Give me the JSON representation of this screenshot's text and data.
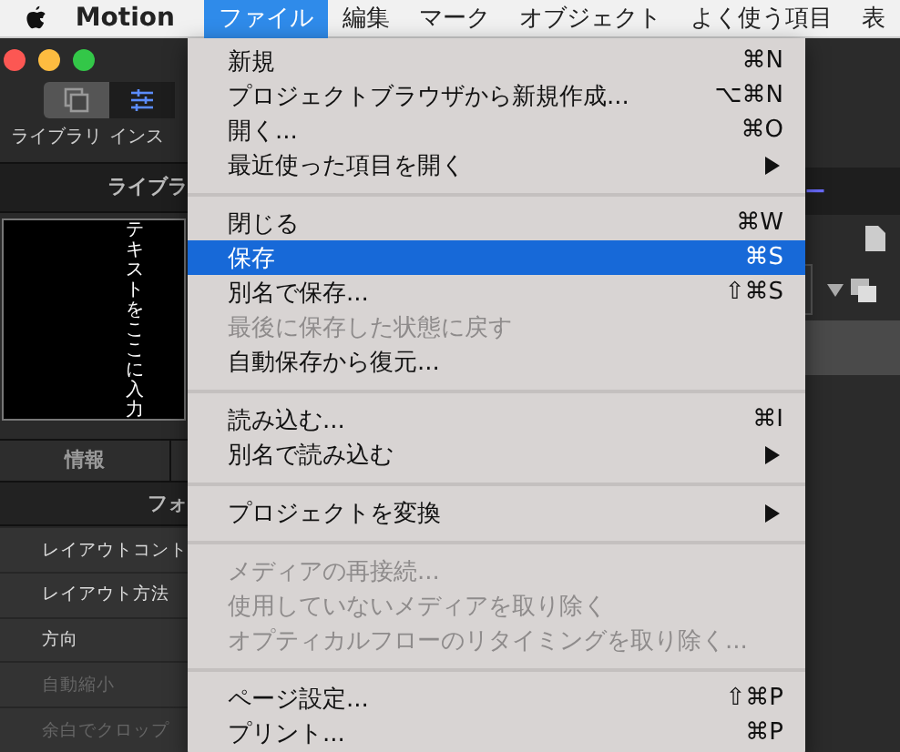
{
  "menubar": {
    "app_name": "Motion",
    "items": [
      {
        "kind": "menu",
        "label": "ファイル",
        "selected": true
      },
      {
        "kind": "menu",
        "label": "編集",
        "selected": false
      },
      {
        "kind": "menu",
        "label": "マーク",
        "selected": false
      },
      {
        "kind": "menu",
        "label": "オブジェクト",
        "selected": false
      },
      {
        "kind": "menu",
        "label": "よく使う項目",
        "selected": false
      },
      {
        "kind": "menu",
        "label": "表",
        "selected": false
      }
    ]
  },
  "file_menu": {
    "items": [
      {
        "kind": "item",
        "label": "新規",
        "shortcut": "⌘N",
        "submenu": false,
        "disabled": false,
        "selected": false
      },
      {
        "kind": "item",
        "label": "プロジェクトブラウザから新規作成...",
        "shortcut": "⌥⌘N",
        "submenu": false,
        "disabled": false,
        "selected": false
      },
      {
        "kind": "item",
        "label": "開く...",
        "shortcut": "⌘O",
        "submenu": false,
        "disabled": false,
        "selected": false
      },
      {
        "kind": "item",
        "label": "最近使った項目を開く",
        "submenu": true,
        "disabled": false,
        "selected": false
      },
      {
        "kind": "separator"
      },
      {
        "kind": "item",
        "label": "閉じる",
        "shortcut": "⌘W",
        "submenu": false,
        "disabled": false,
        "selected": false
      },
      {
        "kind": "item",
        "label": "保存",
        "shortcut": "⌘S",
        "submenu": false,
        "disabled": false,
        "selected": true
      },
      {
        "kind": "item",
        "label": "別名で保存...",
        "shortcut": "⇧⌘S",
        "submenu": false,
        "disabled": false,
        "selected": false
      },
      {
        "kind": "item",
        "label": "最後に保存した状態に戻す",
        "submenu": false,
        "disabled": true,
        "selected": false
      },
      {
        "kind": "item",
        "label": "自動保存から復元...",
        "submenu": false,
        "disabled": false,
        "selected": false
      },
      {
        "kind": "separator"
      },
      {
        "kind": "item",
        "label": "読み込む...",
        "shortcut": "⌘I",
        "submenu": false,
        "disabled": false,
        "selected": false
      },
      {
        "kind": "item",
        "label": "別名で読み込む",
        "submenu": true,
        "disabled": false,
        "selected": false
      },
      {
        "kind": "separator"
      },
      {
        "kind": "item",
        "label": "プロジェクトを変換",
        "submenu": true,
        "disabled": false,
        "selected": false
      },
      {
        "kind": "separator"
      },
      {
        "kind": "item",
        "label": "メディアの再接続...",
        "submenu": false,
        "disabled": true,
        "selected": false
      },
      {
        "kind": "item",
        "label": "使用していないメディアを取り除く",
        "submenu": false,
        "disabled": true,
        "selected": false
      },
      {
        "kind": "item",
        "label": "オプティカルフローのリタイミングを取り除く...",
        "submenu": false,
        "disabled": true,
        "selected": false
      },
      {
        "kind": "separator"
      },
      {
        "kind": "item",
        "label": "ページ設定...",
        "shortcut": "⇧⌘P",
        "submenu": false,
        "disabled": false,
        "selected": false
      },
      {
        "kind": "item",
        "label": "プリント...",
        "shortcut": "⌘P",
        "submenu": false,
        "disabled": false,
        "selected": false
      }
    ]
  },
  "left_panel": {
    "toolbar": [
      {
        "label": "ライブラリ",
        "selected": false
      },
      {
        "label": "インス",
        "selected": true
      }
    ],
    "tab": "ライブラ",
    "preview_text": "テキストをここに入力",
    "inspector_tab": "情報",
    "section": "フォ",
    "rows": [
      {
        "label": "レイアウトコント",
        "disabled": false
      },
      {
        "label": "レイアウト方法",
        "disabled": false
      },
      {
        "label": "方向",
        "disabled": false
      },
      {
        "label": "自動縮小",
        "disabled": true
      },
      {
        "label": "余白でクロップ",
        "disabled": true
      }
    ]
  },
  "right_panel": {
    "tab": "ー"
  }
}
